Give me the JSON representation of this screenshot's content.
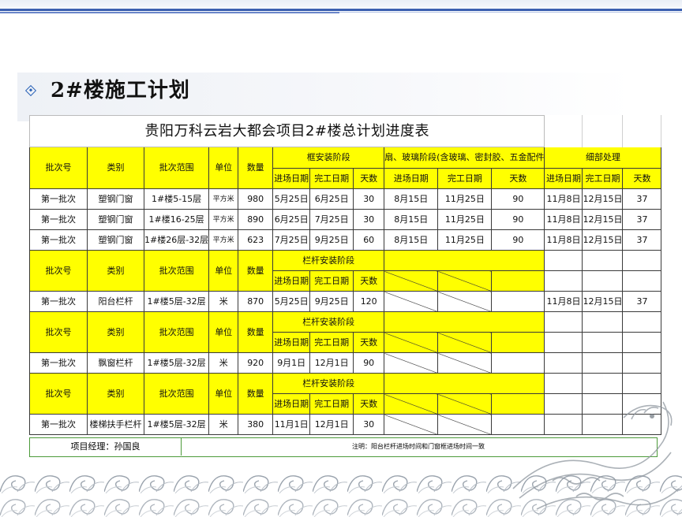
{
  "slide": {
    "title": "2#楼施工计划"
  },
  "table": {
    "title": "贵阳万科云岩大都会项目2#楼总计划进度表",
    "section1": {
      "headers": {
        "batch": "批次号",
        "category": "类别",
        "range": "批次范围",
        "unit": "单位",
        "qty": "数量"
      },
      "phase_frame": "框安装阶段",
      "phase_glass": "扇、玻璃阶段(含玻璃、密封胶、五金配件",
      "phase_detail": "细部处理",
      "sub": {
        "enter": "进场日期",
        "finish": "完工日期",
        "days": "天数"
      },
      "rows": [
        {
          "batch": "第一批次",
          "category": "塑钢门窗",
          "range": "1#楼5-15层",
          "unit": "平方米",
          "qty": "980",
          "f_enter": "5月25日",
          "f_finish": "6月25日",
          "f_days": "30",
          "g_enter": "8月15日",
          "g_finish": "11月25日",
          "g_days": "90",
          "d_enter": "11月8日",
          "d_finish": "12月15日",
          "d_days": "37"
        },
        {
          "batch": "第一批次",
          "category": "塑钢门窗",
          "range": "1#楼16-25层",
          "unit": "平方米",
          "qty": "890",
          "f_enter": "6月25日",
          "f_finish": "7月25日",
          "f_days": "30",
          "g_enter": "8月15日",
          "g_finish": "11月25日",
          "g_days": "90",
          "d_enter": "11月8日",
          "d_finish": "12月15日",
          "d_days": "37"
        },
        {
          "batch": "第一批次",
          "category": "塑钢门窗",
          "range": "1#楼26层-32层",
          "unit": "平方米",
          "qty": "623",
          "f_enter": "7月25日",
          "f_finish": "9月25日",
          "f_days": "60",
          "g_enter": "8月15日",
          "g_finish": "11月25日",
          "g_days": "90",
          "d_enter": "11月8日",
          "d_finish": "12月15日",
          "d_days": "37"
        }
      ]
    },
    "section2": {
      "headers": {
        "batch": "批次号",
        "category": "类别",
        "range": "批次范围",
        "unit": "单位",
        "qty": "数量"
      },
      "phase": "栏杆安装阶段",
      "sub": {
        "enter": "进场日期",
        "finish": "完工日期",
        "days": "天数"
      },
      "row": {
        "batch": "第一批次",
        "category": "阳台栏杆",
        "range": "1#楼5层-32层",
        "unit": "米",
        "qty": "870",
        "enter": "5月25日",
        "finish": "9月25日",
        "days": "120",
        "d_enter": "11月8日",
        "d_finish": "12月15日",
        "d_days": "37"
      }
    },
    "section3": {
      "headers": {
        "batch": "批次号",
        "category": "类别",
        "range": "批次范围",
        "unit": "单位",
        "qty": "数量"
      },
      "phase": "栏杆安装阶段",
      "sub": {
        "enter": "进场日期",
        "finish": "完工日期",
        "days": "天数"
      },
      "row": {
        "batch": "第一批次",
        "category": "飘窗栏杆",
        "range": "1#楼5层-32层",
        "unit": "米",
        "qty": "920",
        "enter": "9月1日",
        "finish": "12月1日",
        "days": "90"
      }
    },
    "section4": {
      "headers": {
        "batch": "批次号",
        "category": "类别",
        "range": "批次范围",
        "unit": "单位",
        "qty": "数量"
      },
      "phase": "栏杆安装阶段",
      "sub": {
        "enter": "进场日期",
        "finish": "完工日期",
        "days": "天数"
      },
      "row": {
        "batch": "第一批次",
        "category": "楼梯扶手栏杆",
        "range": "1#楼5层-32层",
        "unit": "米",
        "qty": "380",
        "enter": "11月1日",
        "finish": "12月1日",
        "days": "30"
      }
    },
    "footer": {
      "manager": "项目经理：孙国良",
      "note": "注明：阳台栏杆进场时间和门窗框进场时间一致"
    }
  },
  "colors": {
    "highlight": "#ffff00",
    "accent": "#3b5fb0",
    "footer_border": "#4c9a3a"
  },
  "decor": {
    "left_bottom": "wave-pattern",
    "right_bottom": "dragon-illustration"
  }
}
